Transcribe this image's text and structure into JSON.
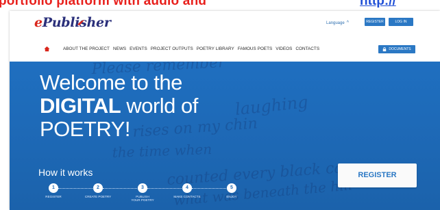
{
  "caption": {
    "text": "portfolio platform with audio and",
    "link": "http://"
  },
  "header": {
    "logo_text": "Publisher",
    "logo_prefix": "e",
    "language_label": "Language",
    "register_label": "REGISTER",
    "login_label": "LOG IN"
  },
  "nav": {
    "items": [
      "ABOUT THE PROJECT",
      "NEWS",
      "EVENTS",
      "PROJECT OUTPUTS",
      "POETRY LIBRARY",
      "FAMOUS POETS",
      "VIDEOS",
      "CONTACTS"
    ],
    "documents_label": "DOCUMENTS"
  },
  "hero": {
    "line1": "Welcome to the",
    "line2_bold": "DIGITAL",
    "line2_rest": "world of",
    "line3": "POETRY!",
    "how_it_works": "How it works",
    "steps": [
      {
        "num": "1",
        "label": "REGISTER"
      },
      {
        "num": "2",
        "label": "CREATE POETRY"
      },
      {
        "num": "3",
        "label": "PUBLISH YOUR POETRY"
      },
      {
        "num": "4",
        "label": "MAKE CONTACTS"
      },
      {
        "num": "5",
        "label": "ENJOY"
      }
    ],
    "register_button": "REGISTER",
    "background_handwriting": [
      "Please remember",
      "laughing",
      "rises on my chin",
      "the time when",
      "counted every black car",
      "what was beneath the hill"
    ]
  },
  "colors": {
    "accent_blue": "#2b78c4",
    "hero_blue": "#1e6ab8",
    "logo_red": "#d9261c",
    "caption_red": "#e8201c"
  }
}
